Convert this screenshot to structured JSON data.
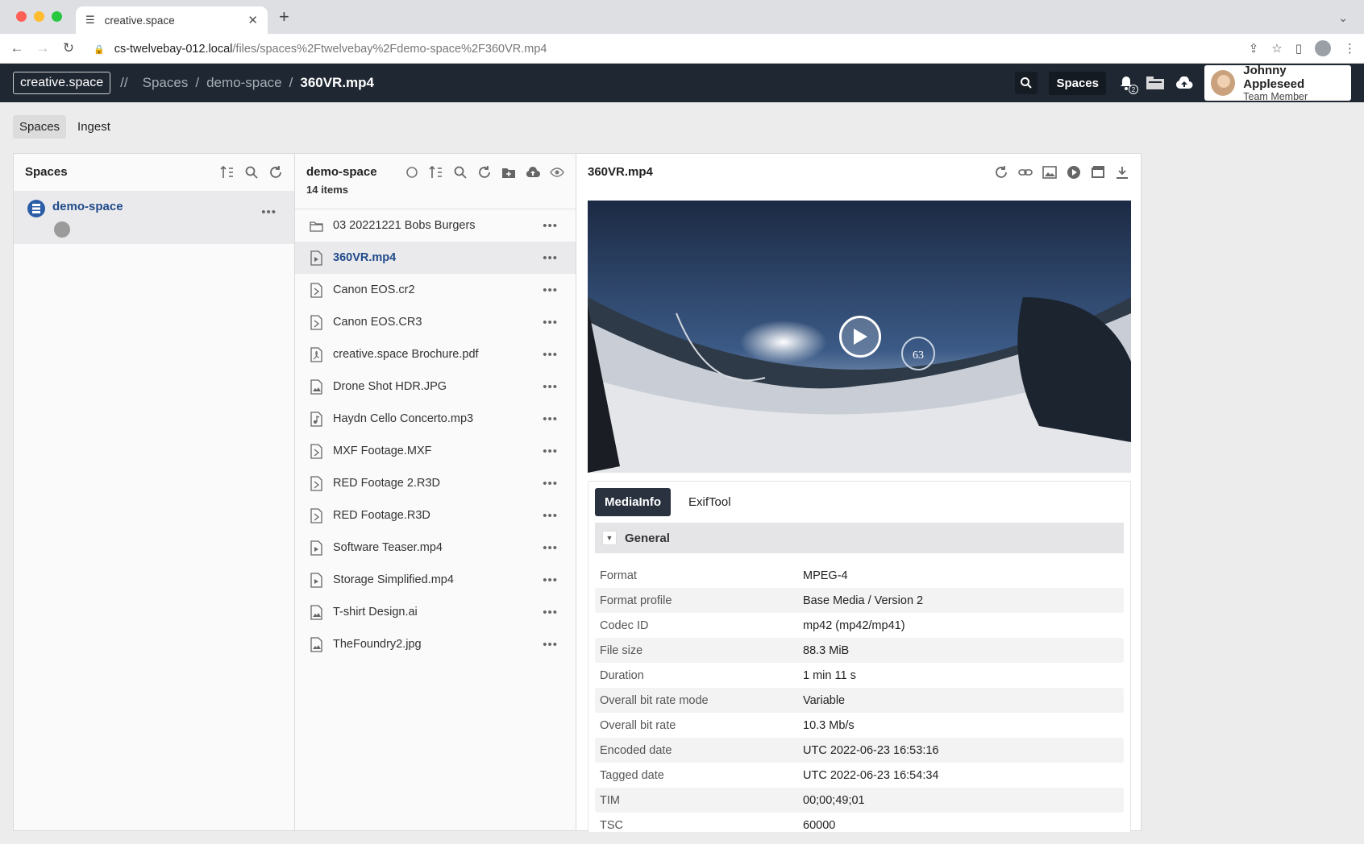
{
  "browser": {
    "tab_title": "creative.space",
    "url_host": "cs-twelvebay-012.local",
    "url_path": "/files/spaces%2Ftwelvebay%2Fdemo-space%2F360VR.mp4"
  },
  "appbar": {
    "brand": "creative.space",
    "prefix": "//",
    "breadcrumbs": [
      "Spaces",
      "demo-space",
      "360VR.mp4"
    ],
    "separator": "/",
    "spaces_button": "Spaces",
    "notification_count": "2",
    "user": {
      "name": "Johnny Appleseed",
      "role": "Team Member"
    }
  },
  "subnav": {
    "items": [
      "Spaces",
      "Ingest"
    ]
  },
  "spaces_panel": {
    "title": "Spaces",
    "space_name": "demo-space"
  },
  "files_panel": {
    "title": "demo-space",
    "count": "14 items",
    "files": [
      {
        "name": "03 20221221 Bobs Burgers",
        "type": "folder"
      },
      {
        "name": "360VR.mp4",
        "type": "video"
      },
      {
        "name": "Canon EOS.cr2",
        "type": "file"
      },
      {
        "name": "Canon EOS.CR3",
        "type": "file"
      },
      {
        "name": "creative.space Brochure.pdf",
        "type": "pdf"
      },
      {
        "name": "Drone Shot HDR.JPG",
        "type": "image"
      },
      {
        "name": "Haydn Cello Concerto.mp3",
        "type": "audio"
      },
      {
        "name": "MXF Footage.MXF",
        "type": "file"
      },
      {
        "name": "RED Footage 2.R3D",
        "type": "file"
      },
      {
        "name": "RED Footage.R3D",
        "type": "file"
      },
      {
        "name": "Software Teaser.mp4",
        "type": "video"
      },
      {
        "name": "Storage Simplified.mp4",
        "type": "video"
      },
      {
        "name": "T-shirt Design.ai",
        "type": "image"
      },
      {
        "name": "TheFoundry2.jpg",
        "type": "image"
      }
    ]
  },
  "preview_panel": {
    "title": "360VR.mp4",
    "overlay_number": "63",
    "tabs": [
      "MediaInfo",
      "ExifTool"
    ],
    "section": "General",
    "rows": [
      {
        "k": "Format",
        "v": "MPEG-4"
      },
      {
        "k": "Format profile",
        "v": "Base Media / Version 2"
      },
      {
        "k": "Codec ID",
        "v": "mp42 (mp42/mp41)"
      },
      {
        "k": "File size",
        "v": "88.3 MiB"
      },
      {
        "k": "Duration",
        "v": "1 min 11 s"
      },
      {
        "k": "Overall bit rate mode",
        "v": "Variable"
      },
      {
        "k": "Overall bit rate",
        "v": "10.3 Mb/s"
      },
      {
        "k": "Encoded date",
        "v": "UTC 2022-06-23 16:53:16"
      },
      {
        "k": "Tagged date",
        "v": "UTC 2022-06-23 16:54:34"
      },
      {
        "k": "TIM",
        "v": "00;00;49;01"
      },
      {
        "k": "TSC",
        "v": "60000"
      }
    ]
  },
  "colors": {
    "appbar": "#1f2732",
    "accent": "#1f4a8a",
    "close": "#ff5f57",
    "minimize": "#febc2e",
    "zoom": "#28c840"
  }
}
